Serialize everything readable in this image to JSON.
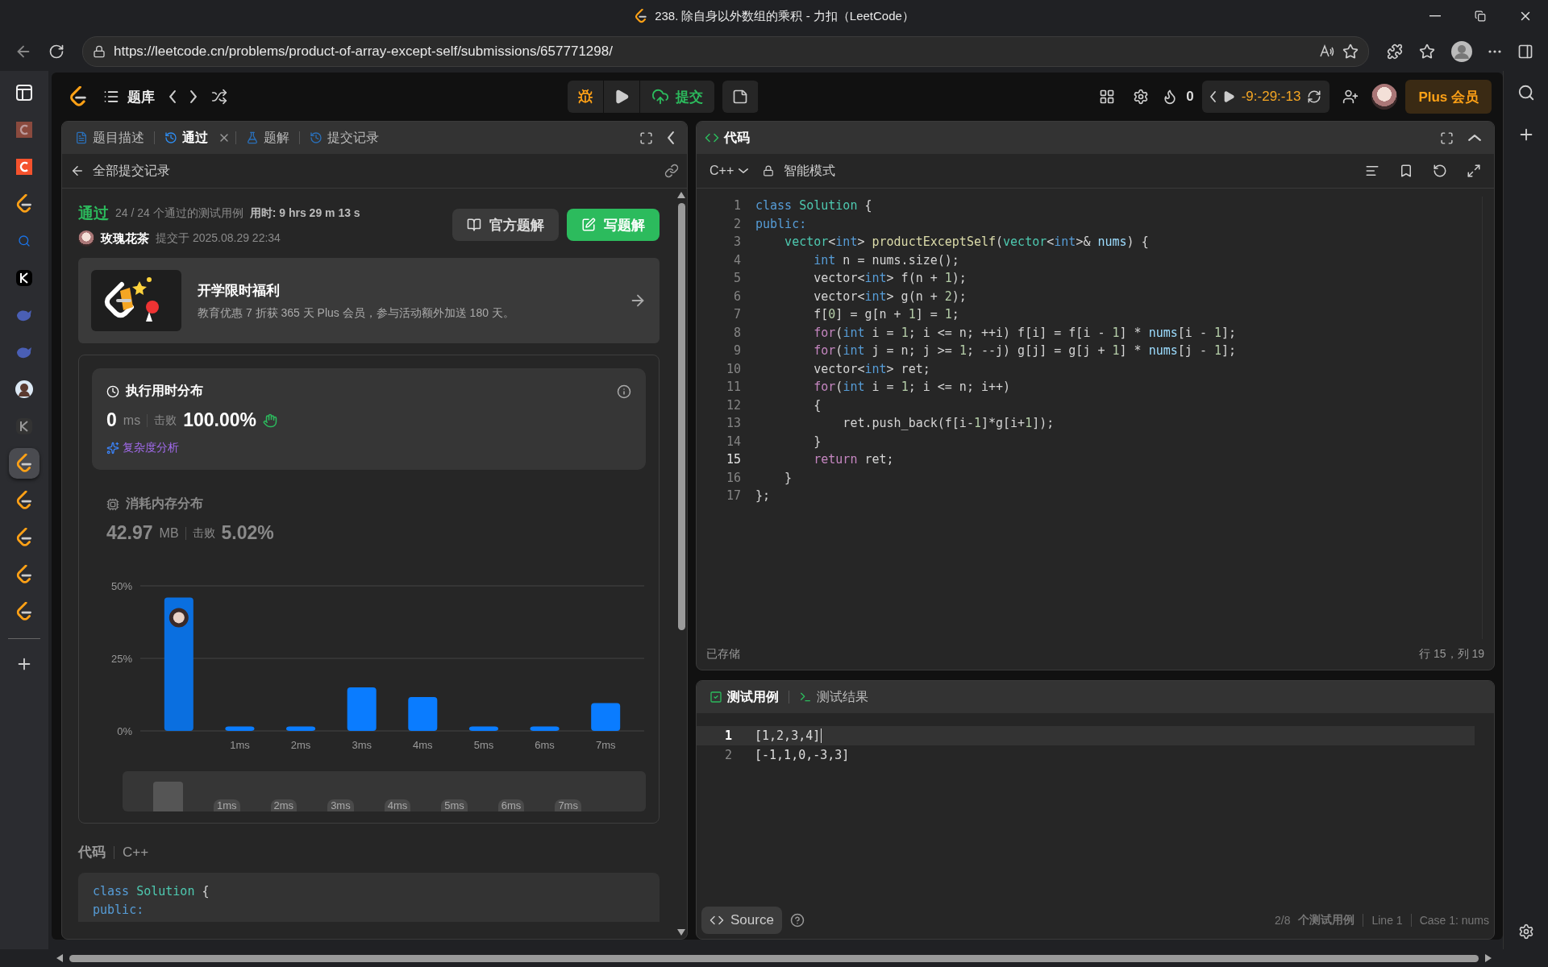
{
  "browser": {
    "title": "238. 除自身以外数组的乘积 - 力扣（LeetCode）",
    "url": "https://leetcode.cn/problems/product-of-array-except-self/submissions/657771298/"
  },
  "browser_sidebar": {
    "items": [
      {
        "kind": "panel",
        "selected": false
      },
      {
        "kind": "c-dim",
        "selected": false
      },
      {
        "kind": "c",
        "selected": false
      },
      {
        "kind": "leetcode",
        "selected": false
      },
      {
        "kind": "search",
        "selected": false
      },
      {
        "kind": "k",
        "selected": false
      },
      {
        "kind": "whale",
        "selected": false
      },
      {
        "kind": "whale",
        "selected": false
      },
      {
        "kind": "avatar",
        "selected": false
      },
      {
        "kind": "k-dim",
        "selected": false
      },
      {
        "kind": "leetcode",
        "selected": true
      },
      {
        "kind": "leetcode",
        "selected": false
      },
      {
        "kind": "leetcode",
        "selected": false
      },
      {
        "kind": "leetcode",
        "selected": false
      },
      {
        "kind": "leetcode",
        "selected": false
      }
    ]
  },
  "top_nav": {
    "problem_list": "题库",
    "submit": "提交",
    "streak": "0",
    "timer": "-9:-29:-13",
    "plus": "Plus 会员"
  },
  "left_panel": {
    "tabs": [
      {
        "label": "题目描述",
        "kind": "doc",
        "selected": false,
        "closable": false
      },
      {
        "label": "通过",
        "kind": "history",
        "selected": true,
        "closable": true
      },
      {
        "label": "题解",
        "kind": "flask",
        "selected": false,
        "closable": false
      },
      {
        "label": "提交记录",
        "kind": "history",
        "selected": false,
        "closable": false
      }
    ],
    "back": "全部提交记录",
    "result": {
      "status": "通过",
      "cases": "24 / 24 个通过的测试用例",
      "time": "用时: 9 hrs 29 m 13 s",
      "user": "玫瑰花茶",
      "submitted": "提交于 2025.08.29 22:34"
    },
    "buttons": [
      "官方题解",
      "写题解"
    ],
    "promo": {
      "title": "开学限时福利",
      "text": "教育优惠 7 折获 365 天 Plus 会员，参与活动额外加送 180 天。"
    },
    "metrics": [
      {
        "kind": "time",
        "title": "执行用时分布",
        "value": "0",
        "unit": "ms",
        "beat_label": "击败",
        "beat": "100.00%",
        "link": "复杂度分析",
        "selected": true
      },
      {
        "kind": "memory",
        "title": "消耗内存分布",
        "value": "42.97",
        "unit": "MB",
        "beat_label": "击败",
        "beat": "5.02%",
        "selected": false
      }
    ],
    "chart_data": {
      "type": "bar",
      "categories": [
        null,
        "1ms",
        "2ms",
        "3ms",
        "4ms",
        "5ms",
        "6ms",
        "7ms"
      ],
      "values": [
        46,
        1.5,
        1.5,
        15,
        11.7,
        1.5,
        1.5,
        9.6
      ],
      "ylim": [
        0,
        50
      ],
      "yticks": [
        {
          "value": 0,
          "label": "0%"
        },
        {
          "value": 25,
          "label": "25%"
        },
        {
          "value": 50,
          "label": "50%"
        }
      ]
    },
    "overview_labels": [
      "1ms",
      "2ms",
      "3ms",
      "4ms",
      "5ms",
      "6ms",
      "7ms"
    ],
    "code_header": {
      "title": "代码",
      "language": "C++"
    },
    "code_preview": [
      [
        {
          "kind": "kw",
          "text": "class "
        },
        {
          "kind": "ty",
          "text": "Solution"
        },
        {
          "kind": "p",
          "text": " {"
        }
      ],
      [
        {
          "kind": "kw",
          "text": "public:"
        }
      ]
    ]
  },
  "editor": {
    "title": "代码",
    "language": "C++",
    "mode": "智能模式",
    "saved": "已存储",
    "cursor": "行 15，列 19",
    "lines": [
      {
        "no": "1",
        "active": false,
        "tokens": [
          {
            "kind": "kw",
            "text": "class "
          },
          {
            "kind": "ty",
            "text": "Solution"
          },
          {
            "kind": "p",
            "text": " {"
          }
        ]
      },
      {
        "no": "2",
        "active": false,
        "tokens": [
          {
            "kind": "kw",
            "text": "public:"
          }
        ]
      },
      {
        "no": "3",
        "active": false,
        "tokens": [
          {
            "kind": "ty",
            "text": "    vector"
          },
          {
            "kind": "p",
            "text": "<"
          },
          {
            "kind": "kw",
            "text": "int"
          },
          {
            "kind": "p",
            "text": "> "
          },
          {
            "kind": "fn",
            "text": "productExceptSelf"
          },
          {
            "kind": "p",
            "text": "("
          },
          {
            "kind": "ty",
            "text": "vector"
          },
          {
            "kind": "p",
            "text": "<"
          },
          {
            "kind": "kw",
            "text": "int"
          },
          {
            "kind": "p",
            "text": ">& "
          },
          {
            "kind": "var",
            "text": "nums"
          },
          {
            "kind": "p",
            "text": ") {"
          }
        ]
      },
      {
        "no": "4",
        "active": false,
        "tokens": [
          {
            "kind": "kw",
            "text": "        int"
          },
          {
            "kind": "p",
            "text": " n = nums.size();"
          }
        ]
      },
      {
        "no": "5",
        "active": false,
        "tokens": [
          {
            "kind": "p",
            "text": "        vector<"
          },
          {
            "kind": "kw",
            "text": "int"
          },
          {
            "kind": "p",
            "text": "> f(n + "
          },
          {
            "kind": "num",
            "text": "1"
          },
          {
            "kind": "p",
            "text": ");"
          }
        ]
      },
      {
        "no": "6",
        "active": false,
        "tokens": [
          {
            "kind": "p",
            "text": "        vector<"
          },
          {
            "kind": "kw",
            "text": "int"
          },
          {
            "kind": "p",
            "text": "> g(n + "
          },
          {
            "kind": "num",
            "text": "2"
          },
          {
            "kind": "p",
            "text": ");"
          }
        ]
      },
      {
        "no": "7",
        "active": false,
        "tokens": [
          {
            "kind": "p",
            "text": "        f["
          },
          {
            "kind": "num",
            "text": "0"
          },
          {
            "kind": "p",
            "text": "] = g[n + "
          },
          {
            "kind": "num",
            "text": "1"
          },
          {
            "kind": "p",
            "text": "] = "
          },
          {
            "kind": "num",
            "text": "1"
          },
          {
            "kind": "p",
            "text": ";"
          }
        ]
      },
      {
        "no": "8",
        "active": false,
        "tokens": [
          {
            "kind": "ctl",
            "text": "        for"
          },
          {
            "kind": "p",
            "text": "("
          },
          {
            "kind": "kw",
            "text": "int"
          },
          {
            "kind": "p",
            "text": " i = "
          },
          {
            "kind": "num",
            "text": "1"
          },
          {
            "kind": "p",
            "text": "; i <= n; ++i) f[i] = f[i - "
          },
          {
            "kind": "num",
            "text": "1"
          },
          {
            "kind": "p",
            "text": "] * "
          },
          {
            "kind": "var",
            "text": "nums"
          },
          {
            "kind": "p",
            "text": "[i - "
          },
          {
            "kind": "num",
            "text": "1"
          },
          {
            "kind": "p",
            "text": "];"
          }
        ]
      },
      {
        "no": "9",
        "active": false,
        "tokens": [
          {
            "kind": "ctl",
            "text": "        for"
          },
          {
            "kind": "p",
            "text": "("
          },
          {
            "kind": "kw",
            "text": "int"
          },
          {
            "kind": "p",
            "text": " j = n; j >= "
          },
          {
            "kind": "num",
            "text": "1"
          },
          {
            "kind": "p",
            "text": "; --j) g[j] = g[j + "
          },
          {
            "kind": "num",
            "text": "1"
          },
          {
            "kind": "p",
            "text": "] * "
          },
          {
            "kind": "var",
            "text": "nums"
          },
          {
            "kind": "p",
            "text": "[j - "
          },
          {
            "kind": "num",
            "text": "1"
          },
          {
            "kind": "p",
            "text": "];"
          }
        ]
      },
      {
        "no": "10",
        "active": false,
        "tokens": [
          {
            "kind": "p",
            "text": "        vector<"
          },
          {
            "kind": "kw",
            "text": "int"
          },
          {
            "kind": "p",
            "text": "> ret;"
          }
        ]
      },
      {
        "no": "11",
        "active": false,
        "tokens": [
          {
            "kind": "ctl",
            "text": "        for"
          },
          {
            "kind": "p",
            "text": "("
          },
          {
            "kind": "kw",
            "text": "int"
          },
          {
            "kind": "p",
            "text": " i = "
          },
          {
            "kind": "num",
            "text": "1"
          },
          {
            "kind": "p",
            "text": "; i <= n; i++)"
          }
        ]
      },
      {
        "no": "12",
        "active": false,
        "tokens": [
          {
            "kind": "p",
            "text": "        {"
          }
        ]
      },
      {
        "no": "13",
        "active": false,
        "tokens": [
          {
            "kind": "p",
            "text": "            ret.push_back(f[i-"
          },
          {
            "kind": "num",
            "text": "1"
          },
          {
            "kind": "p",
            "text": "]*g[i+"
          },
          {
            "kind": "num",
            "text": "1"
          },
          {
            "kind": "p",
            "text": "]);"
          }
        ]
      },
      {
        "no": "14",
        "active": false,
        "tokens": [
          {
            "kind": "p",
            "text": "        }"
          }
        ]
      },
      {
        "no": "15",
        "active": true,
        "tokens": [
          {
            "kind": "ctl",
            "text": "        return"
          },
          {
            "kind": "p",
            "text": " ret;"
          }
        ]
      },
      {
        "no": "16",
        "active": false,
        "tokens": [
          {
            "kind": "p",
            "text": "    }"
          }
        ]
      },
      {
        "no": "17",
        "active": false,
        "tokens": [
          {
            "kind": "p",
            "text": "};"
          }
        ]
      }
    ]
  },
  "test_panel": {
    "tabs": [
      {
        "label": "测试用例",
        "kind": "check",
        "selected": true
      },
      {
        "label": "测试结果",
        "kind": "terminal",
        "selected": false
      }
    ],
    "lines": [
      {
        "no": "1",
        "text": "[1,2,3,4]",
        "active": true
      },
      {
        "no": "2",
        "text": "[-1,1,0,-3,3]",
        "active": false
      }
    ],
    "source": "Source",
    "count": "2/8",
    "count_label": "个测试用例",
    "line": "Line 1",
    "case": "Case 1: nums"
  }
}
